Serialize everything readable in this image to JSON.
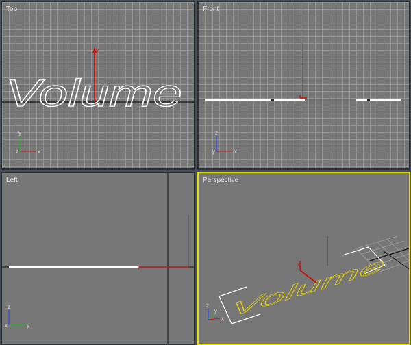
{
  "viewports": {
    "top": {
      "label": "Top"
    },
    "front": {
      "label": "Front"
    },
    "left": {
      "label": "Left"
    },
    "persp": {
      "label": "Perspective"
    }
  },
  "object": {
    "text": "Volume"
  },
  "axis_labels": {
    "x": "x",
    "y": "y",
    "z": "z"
  },
  "colors": {
    "viewport_bg": "#777777",
    "grid": "#969696",
    "active_border": "#e6e000",
    "axis_x": "#d01818",
    "axis_y": "#18c018",
    "axis_z": "#2040ff",
    "selected_object": "#e8d200",
    "outline": "#ffffff"
  }
}
